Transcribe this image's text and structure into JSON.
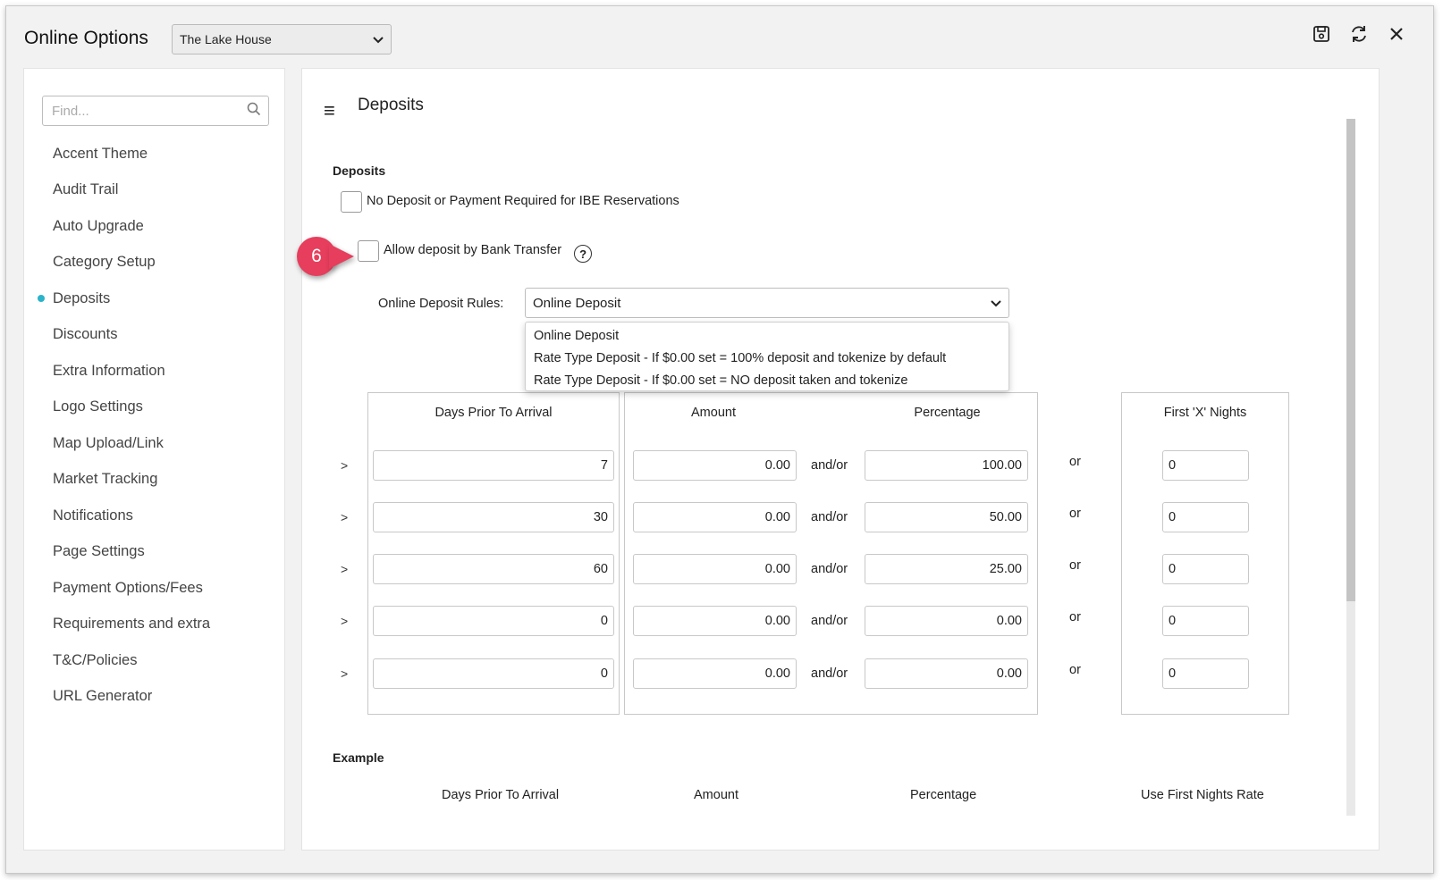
{
  "window": {
    "title": "Online Options",
    "property_select": "The Lake House",
    "icons": [
      "save-icon",
      "refresh-icon",
      "close-icon"
    ]
  },
  "sidebar": {
    "search_placeholder": "Find...",
    "items": [
      {
        "label": "Accent Theme",
        "active": false
      },
      {
        "label": "Audit Trail",
        "active": false
      },
      {
        "label": "Auto Upgrade",
        "active": false
      },
      {
        "label": "Category Setup",
        "active": false
      },
      {
        "label": "Deposits",
        "active": true
      },
      {
        "label": "Discounts",
        "active": false
      },
      {
        "label": "Extra Information",
        "active": false
      },
      {
        "label": "Logo Settings",
        "active": false
      },
      {
        "label": "Map Upload/Link",
        "active": false
      },
      {
        "label": "Market Tracking",
        "active": false
      },
      {
        "label": "Notifications",
        "active": false
      },
      {
        "label": "Page Settings",
        "active": false
      },
      {
        "label": "Payment Options/Fees",
        "active": false
      },
      {
        "label": "Requirements and extra",
        "active": false
      },
      {
        "label": "T&C/Policies",
        "active": false
      },
      {
        "label": "URL Generator",
        "active": false
      }
    ],
    "active_color": "#2ab3c9"
  },
  "main": {
    "header_title": "Deposits",
    "section_label": "Deposits",
    "no_deposit_label": "No Deposit or Payment Required for IBE Reservations",
    "bank_transfer_label": "Allow deposit by Bank Transfer",
    "help_glyph": "?",
    "callout_number": "6",
    "callout_color": "#e63e5c",
    "rules_label": "Online Deposit Rules:",
    "rules_selected": "Online Deposit",
    "rules_options": [
      "Online Deposit",
      "Rate Type Deposit - If $0.00 set = 100% deposit and tokenize by default",
      "Rate Type Deposit - If $0.00 set = NO deposit taken and tokenize"
    ],
    "table": {
      "headers": {
        "days": "Days Prior To Arrival",
        "amount": "Amount",
        "percentage": "Percentage",
        "first_nights": "First 'X' Nights"
      },
      "row_prefix": ">",
      "andor": "and/or",
      "or": "or",
      "rows": [
        {
          "days": "7",
          "amount": "0.00",
          "percentage": "100.00",
          "nights": "0"
        },
        {
          "days": "30",
          "amount": "0.00",
          "percentage": "50.00",
          "nights": "0"
        },
        {
          "days": "60",
          "amount": "0.00",
          "percentage": "25.00",
          "nights": "0"
        },
        {
          "days": "0",
          "amount": "0.00",
          "percentage": "0.00",
          "nights": "0"
        },
        {
          "days": "0",
          "amount": "0.00",
          "percentage": "0.00",
          "nights": "0"
        }
      ]
    },
    "example": {
      "label": "Example",
      "headers": [
        "Days Prior To Arrival",
        "Amount",
        "Percentage",
        "Use First Nights Rate"
      ]
    }
  }
}
